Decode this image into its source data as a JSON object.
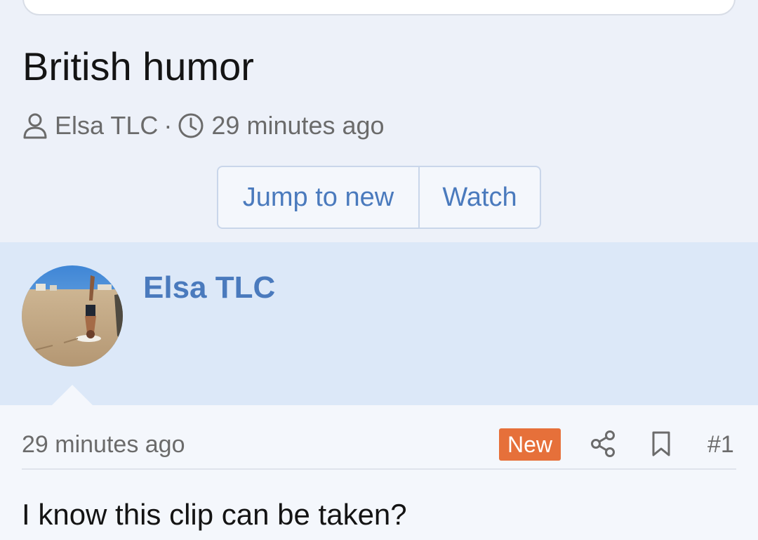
{
  "thread": {
    "title": "British humor",
    "author": "Elsa TLC",
    "separator": "·",
    "time": "29 minutes ago"
  },
  "actions": {
    "jump_label": "Jump to new",
    "watch_label": "Watch"
  },
  "post": {
    "username": "Elsa TLC",
    "avatar_alt": "Elsa TLC",
    "time": "29 minutes ago",
    "badge": "New",
    "number": "#1",
    "text": "I know this clip can be taken?"
  },
  "icons": {
    "author": "user-icon",
    "time": "clock-icon",
    "share": "share-icon",
    "bookmark": "bookmark-icon"
  },
  "colors": {
    "accent": "#4a7abd",
    "badge": "#e6703a",
    "band": "#dce8f8",
    "background": "#edf1f9"
  }
}
